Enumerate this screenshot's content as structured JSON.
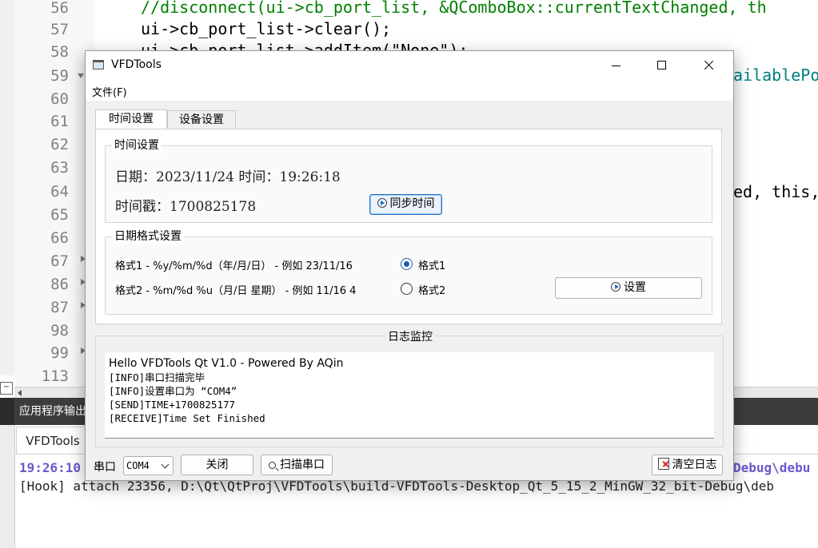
{
  "ide": {
    "line_numbers": [
      "56",
      "57",
      "58",
      "59",
      "60",
      "61",
      "62",
      "63",
      "64",
      "65",
      "66",
      "67",
      "86",
      "87",
      "98",
      "99",
      "113"
    ],
    "code_lines": [
      {
        "text": "//disconnect(ui->cb_port_list, &QComboBox::currentTextChanged, th",
        "color": "#008000"
      },
      {
        "text": "ui->cb_port_list->clear();",
        "color": "#000000"
      },
      {
        "text": "ui->cb_port_list->addItem(\"None\");",
        "color": "#000000"
      }
    ],
    "code_fragments": [
      "ailablePo",
      "ed, this,"
    ],
    "output_pane_title": "应用程序输出",
    "output_tab": "VFDTools",
    "output_time": "19:26:10",
    "output_tail": "Debug\\debu",
    "output_hook": "[Hook] attach 23356, D:\\Qt\\QtProj\\VFDTools\\build-VFDTools-Desktop_Qt_5_15_2_MinGW_32_bit-Debug\\deb"
  },
  "window": {
    "title": "VFDTools",
    "menu_file": "文件(F)",
    "tabs": [
      {
        "label": "时间设置",
        "active": true
      },
      {
        "label": "设备设置",
        "active": false
      }
    ],
    "time_group": {
      "title": "时间设置",
      "date_label": "日期：",
      "date_value": "2023/11/24",
      "time_label": "时间：",
      "time_value": "19:26:18",
      "stamp_label": "时间戳：",
      "stamp_value": "1700825178",
      "sync_button": "同步时间"
    },
    "format_group": {
      "title": "日期格式设置",
      "format1_text": "格式1 - %y/%m/%d（年/月/日） - 例如 23/11/16",
      "format1_radio": "格式1",
      "format1_selected": true,
      "format2_text": "格式2 - %m/%d %u（月/日 星期） - 例如 11/16 4",
      "format2_radio": "格式2",
      "format2_selected": false,
      "set_button": "设置"
    },
    "log": {
      "title": "日志监控",
      "lines": [
        "Hello VFDTools Qt  V1.0 - Powered By AQin",
        "[INFO]串口扫描完毕",
        "[INFO]设置串口为 “COM4”",
        "[SEND]TIME+1700825177",
        "[RECEIVE]Time Set Finished"
      ]
    },
    "bottom": {
      "port_label": "串口",
      "port_value": "COM4",
      "close_button": "关闭",
      "scan_button": "扫描串口",
      "clear_button": "清空日志"
    }
  },
  "colors": {
    "accent": "#1a73c9",
    "code_green": "#008000",
    "code_teal": "#008080",
    "time_blue": "#6a5acd"
  }
}
